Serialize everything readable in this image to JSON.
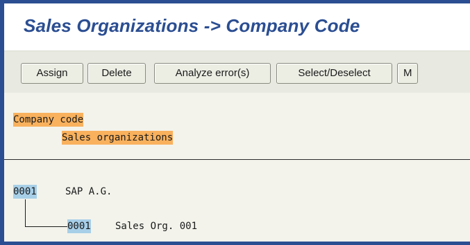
{
  "window": {
    "title": "Sales Organizations -> Company Code"
  },
  "toolbar": {
    "buttons": [
      {
        "label": "Assign"
      },
      {
        "label": "Delete"
      },
      {
        "label": "Analyze error(s)"
      },
      {
        "label": "Select/Deselect"
      },
      {
        "label": "M"
      }
    ]
  },
  "header": {
    "level1": "Company code",
    "level2": "Sales organizations"
  },
  "tree": {
    "company": {
      "code": "0001",
      "name": "SAP A.G."
    },
    "sales_org": {
      "code": "0001",
      "name": "Sales Org. 001"
    }
  },
  "colors": {
    "title_blue": "#2b4e92",
    "highlight_orange": "#f9b15d",
    "highlight_blue": "#a7cfe8",
    "toolbar_bg": "#e8e9e0",
    "content_bg": "#f3f3ec"
  }
}
